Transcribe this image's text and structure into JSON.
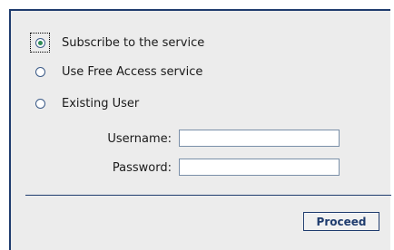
{
  "options": [
    {
      "label": "Subscribe to the service",
      "selected": true
    },
    {
      "label": "Use Free Access service",
      "selected": false
    },
    {
      "label": "Existing User",
      "selected": false
    }
  ],
  "login": {
    "username_label": "Username:",
    "username_value": "",
    "password_label": "Password:",
    "password_value": ""
  },
  "actions": {
    "proceed_label": "Proceed"
  },
  "colors": {
    "panel_background": "#ececec",
    "border_accent": "#1f3c6e",
    "radio_selected": "#2e8b57"
  }
}
